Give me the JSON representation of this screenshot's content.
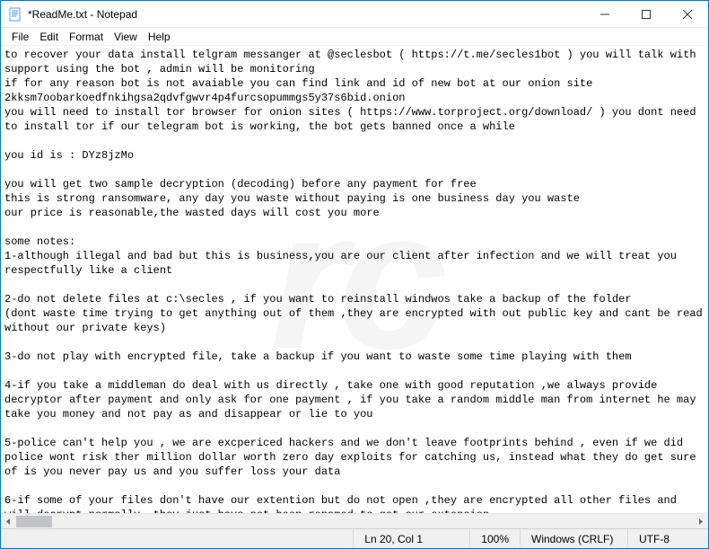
{
  "window": {
    "title": "*ReadMe.txt - Notepad"
  },
  "menu": {
    "file": "File",
    "edit": "Edit",
    "format": "Format",
    "view": "View",
    "help": "Help"
  },
  "body_text": "to recover your data install telgram messanger at @seclesbot ( https://t.me/secles1bot ) you will talk with support using the bot , admin will be monitoring\nif for any reason bot is not avaiable you can find link and id of new bot at our onion site 2kksm7oobarkoedfnkihgsa2qdvfgwvr4p4furcsopummgs5y37s6bid.onion\nyou will need to install tor browser for onion sites ( https://www.torproject.org/download/ ) you dont need to install tor if our telegram bot is working, the bot gets banned once a while\n\nyou id is : DYz8jzMo\n\nyou will get two sample decryption (decoding) before any payment for free\nthis is strong ransomware, any day you waste without paying is one business day you waste\nour price is reasonable,the wasted days will cost you more\n\nsome notes:\n1-although illegal and bad but this is business,you are our client after infection and we will treat you respectfully like a client\n\n2-do not delete files at c:\\secles , if you want to reinstall windwos take a backup of the folder\n(dont waste time trying to get anything out of them ,they are encrypted with out public key and cant be read without our private keys)\n\n3-do not play with encrypted file, take a backup if you want to waste some time playing with them\n\n4-if you take a middleman do deal with us directly , take one with good reputation ,we always provide decryptor after payment and only ask for one payment , if you take a random middle man from internet he may take you money and not pay as and disappear or lie to you\n\n5-police can't help you , we are excpericed hackers and we don't leave footprints behind , even if we did police wont risk ther million dollar worth zero day exploits for catching us, instead what they do get sure of is you never pay us and you suffer loss your data\n\n6-if some of your files don't have our extention but do not open ,they are encrypted all other files and will decrypt normally ,they just have not been renamed to get our extension",
  "status": {
    "position": "Ln 20, Col 1",
    "zoom": "100%",
    "line_ending": "Windows (CRLF)",
    "encoding": "UTF-8"
  },
  "watermark": "rc"
}
